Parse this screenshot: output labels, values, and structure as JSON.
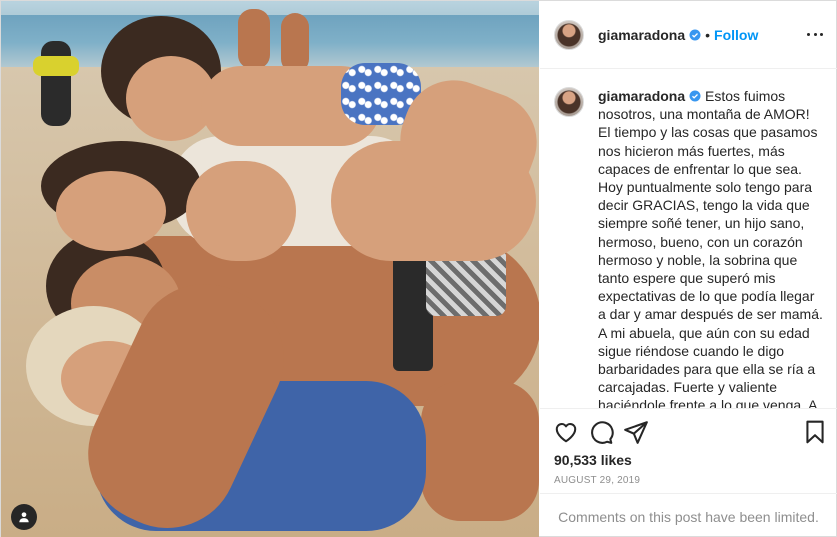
{
  "post": {
    "photo": {
      "alt_icon": "user-tag-icon"
    },
    "header": {
      "username": "giamaradona",
      "separator": "•",
      "follow_label": "Follow",
      "more_icon": "more-options-icon",
      "verified_icon": "verified-badge-icon"
    },
    "caption": {
      "username": "giamaradona",
      "text": "Estos fuimos nosotros, una montaña de AMOR! El tiempo y las cosas que pasamos nos hicieron más fuertes, más capaces de enfrentar lo que sea. Hoy puntualmente solo tengo para decir GRACIAS, tengo la vida que siempre soñé tener, un hijo sano, hermoso, bueno, con un corazón hermoso y noble, la sobrina que tanto espere que superó mis expectativas de lo que podía llegar a dar y amar después de ser mamá. A mi abuela, que aún con su edad sigue riéndose cuando le digo barbaridades para que ella se ría a carcajadas. Fuerte y valiente haciéndole frente a lo que venga. A mi mamá que cada día valoro y admiro más. Sos de otro planeta. Pasan mil cosas y nosotras seguimos"
    },
    "actions": {
      "like_icon": "heart-icon",
      "comment_icon": "comment-icon",
      "share_icon": "share-icon",
      "save_icon": "bookmark-icon"
    },
    "likes": "90,533 likes",
    "date": "AUGUST 29, 2019",
    "comments_limited": "Comments on this post have been limited.",
    "colors": {
      "link_blue": "#0095f6",
      "verified_blue": "#3897f0",
      "text": "#262626",
      "muted": "#8e8e8e",
      "border": "#dbdbdb"
    }
  }
}
